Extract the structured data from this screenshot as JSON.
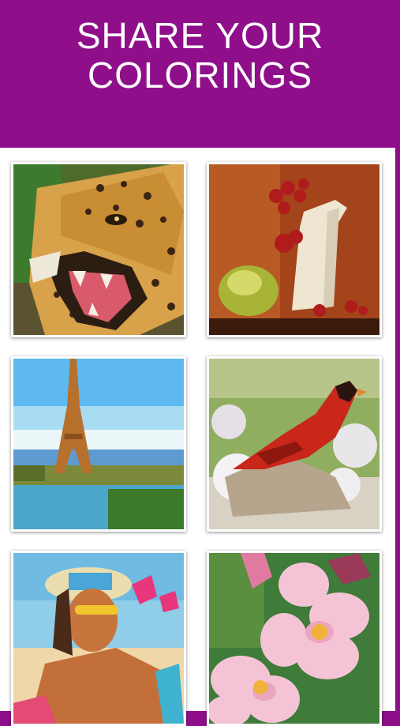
{
  "header": {
    "title_line1": "SHARE YOUR",
    "title_line2": "COLORINGS",
    "background_color": "#8f0f8a"
  },
  "gallery": {
    "items": [
      {
        "subject": "leopard-roaring"
      },
      {
        "subject": "still-life-vase-cherries-pear"
      },
      {
        "subject": "eiffel-tower"
      },
      {
        "subject": "red-cardinal-bird"
      },
      {
        "subject": "woman-sunglasses-beach"
      },
      {
        "subject": "pink-flowers"
      }
    ]
  }
}
